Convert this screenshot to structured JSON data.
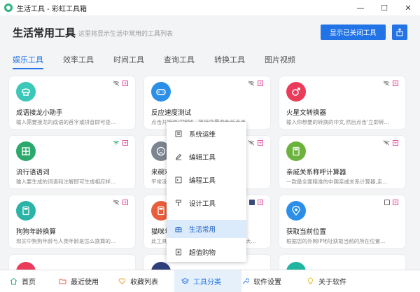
{
  "window": {
    "title": "生活工具 - 彩虹工具箱",
    "minimize": "—",
    "maximize": "☐",
    "close": "✕"
  },
  "header": {
    "title": "生活常用工具",
    "subtitle": "这里将显示生活中常用的工具列表",
    "toggle_button": "显示已关闭工具"
  },
  "tabs": [
    "娱乐工具",
    "效率工具",
    "时间工具",
    "查询工具",
    "转换工具",
    "图片视频"
  ],
  "cards": [
    {
      "title": "成语接龙小助手",
      "desc": "输入需要接龙的成语的首字或拼音即可查..."
    },
    {
      "title": "反应速度测试",
      "desc": "点击开始测试按钮，等待背景变色后点击"
    },
    {
      "title": "火星文转换器",
      "desc": "输入你想要的转换的中文,然后点击'立即转..."
    },
    {
      "title": "流行语语词",
      "desc": "输入要生成的词语和注解即可生成相应样..."
    },
    {
      "title": "来碗鸡汤",
      "desc": "平常没什么"
    },
    {
      "title": "亲戚关系称呼计算器",
      "desc": "一款最全面精准的中国亲戚关系计算器,走..."
    },
    {
      "title": "狗狗年龄换算",
      "desc": "现实中狗狗年龄与人类年龄是怎么换算的..."
    },
    {
      "title": "猫咪年龄",
      "desc": "此工具可以帮你计算出猫咪相当于人类的大..."
    },
    {
      "title": "获取当前位置",
      "desc": "根据您的外网IP地址获取当前的所在位置..."
    }
  ],
  "menu": [
    "系统运维",
    "编辑工具",
    "编程工具",
    "设计工具",
    "生活常用",
    "超值购物"
  ],
  "bottom_nav": [
    "首页",
    "最近使用",
    "收藏列表",
    "工具分类",
    "软件设置",
    "关于软件"
  ]
}
